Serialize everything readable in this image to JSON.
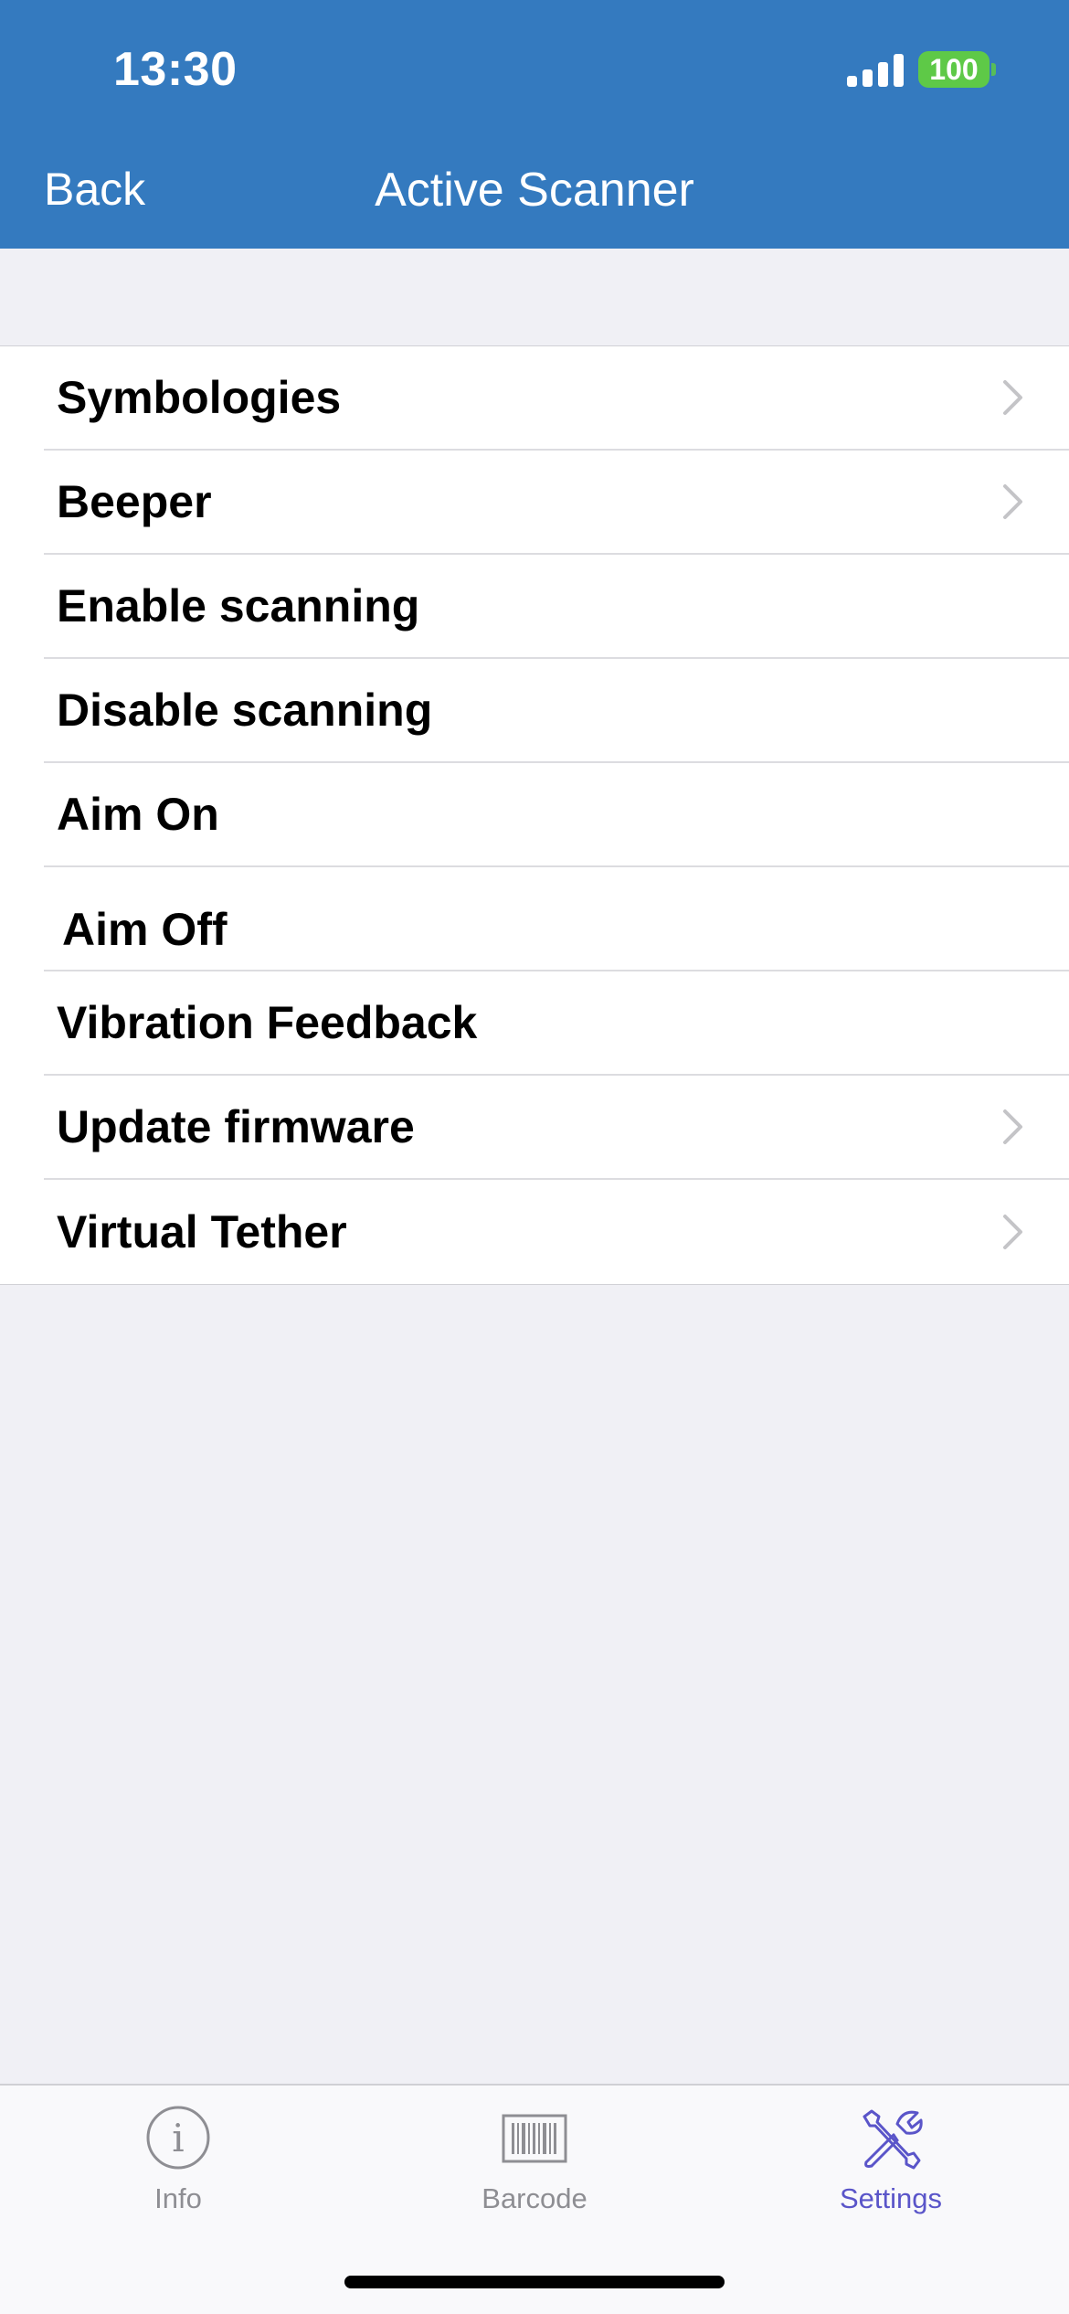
{
  "status_bar": {
    "time": "13:30",
    "battery": "100",
    "battery_color": "#5ec947"
  },
  "nav_bar": {
    "back_label": "Back",
    "title": "Active Scanner",
    "color": "#347abf"
  },
  "settings": {
    "items": [
      {
        "label": "Symbologies",
        "chevron": true
      },
      {
        "label": "Beeper",
        "chevron": true
      },
      {
        "label": "Enable scanning",
        "chevron": false
      },
      {
        "label": "Disable scanning",
        "chevron": false
      },
      {
        "label": "Aim On",
        "chevron": false
      },
      {
        "label": "Aim Off",
        "chevron": false
      },
      {
        "label": "Vibration Feedback",
        "chevron": false
      },
      {
        "label": "Update firmware",
        "chevron": true
      },
      {
        "label": "Virtual Tether",
        "chevron": true
      }
    ]
  },
  "tab_bar": {
    "tabs": [
      {
        "label": "Info",
        "icon": "info-icon",
        "active": false
      },
      {
        "label": "Barcode",
        "icon": "barcode-icon",
        "active": false
      },
      {
        "label": "Settings",
        "icon": "settings-tools-icon",
        "active": true
      }
    ],
    "active_color": "#5a55c9",
    "inactive_color": "#8e8e93"
  }
}
